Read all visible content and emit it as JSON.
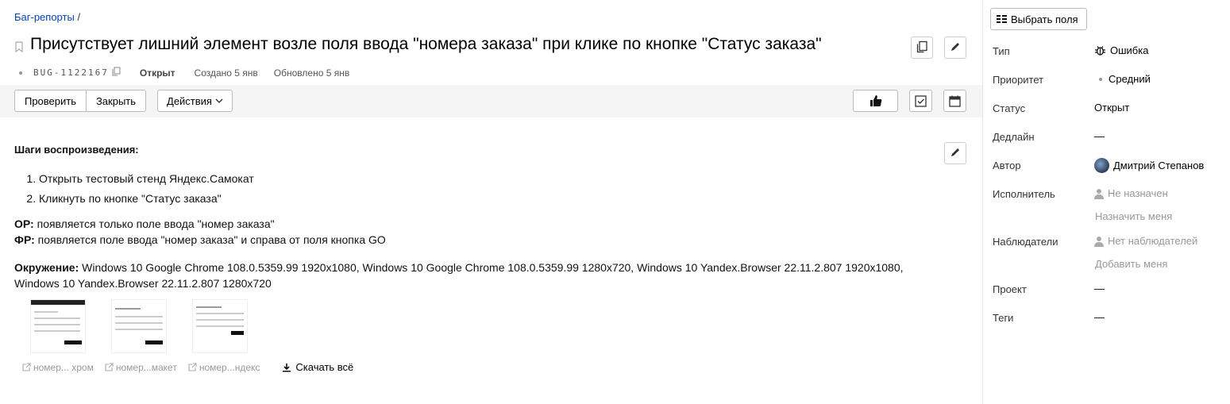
{
  "breadcrumb": {
    "link": "Баг-репорты",
    "sep": "/"
  },
  "issue": {
    "title": "Присутствует лишний элемент возле поля ввода \"номера заказа\" при клике по кнопке \"Статус заказа\"",
    "key": "BUG-1122167",
    "status": "Открыт",
    "created": "Создано 5 янв",
    "updated": "Обновлено 5 янв"
  },
  "toolbar": {
    "check": "Проверить",
    "close": "Закрыть",
    "actions": "Действия"
  },
  "description": {
    "steps_title": "Шаги воспроизведения:",
    "steps": [
      "Открыть тестовый стенд Яндекс.Самокат",
      "Кликнуть по кнопке \"Статус заказа\""
    ],
    "expected_label": "ОР:",
    "expected": " появляется только поле ввода \"номер заказа\"",
    "actual_label": "ФР:",
    "actual": " появляется поле ввода \"номер заказа\" и справа от поля кнопка GO",
    "env_label": "Окружение:",
    "env_line1": " Windows 10 Google Chrome 108.0.5359.99 1920x1080, Windows 10 Google Chrome 108.0.5359.99 1280x720, Windows 10 Yandex.Browser 22.11.2.807 1920x1080,",
    "env_line2": "Windows 10 Yandex.Browser 22.11.2.807 1280x720"
  },
  "attachments": {
    "files": [
      "номер... хром",
      "номер...макет",
      "номер...ндекс"
    ],
    "download_all": "Скачать всё"
  },
  "sidebar": {
    "pick_fields": "Выбрать поля",
    "fields": {
      "type_label": "Тип",
      "type_value": "Ошибка",
      "priority_label": "Приоритет",
      "priority_value": "Средний",
      "status_label": "Статус",
      "status_value": "Открыт",
      "deadline_label": "Дедлайн",
      "deadline_value": "—",
      "author_label": "Автор",
      "author_value": "Дмитрий Степанов",
      "assignee_label": "Исполнитель",
      "assignee_value": "Не назначен",
      "assign_me": "Назначить меня",
      "watchers_label": "Наблюдатели",
      "watchers_value": "Нет наблюдателей",
      "add_me": "Добавить меня",
      "project_label": "Проект",
      "project_value": "—",
      "tags_label": "Теги",
      "tags_value": "—"
    }
  },
  "icons": {
    "bookmark": "bookmark-icon",
    "copy": "copy-icon",
    "edit": "pencil-icon",
    "like": "thumbs-up-icon",
    "checklist": "checkbox-icon",
    "calendar": "calendar-icon",
    "bug": "bug-icon",
    "person": "person-icon",
    "external": "external-link-icon",
    "download": "download-icon",
    "columns": "columns-icon"
  },
  "colors": {
    "link": "#0044bb",
    "muted": "#999999",
    "toolbar_bg": "#f5f5f5"
  }
}
